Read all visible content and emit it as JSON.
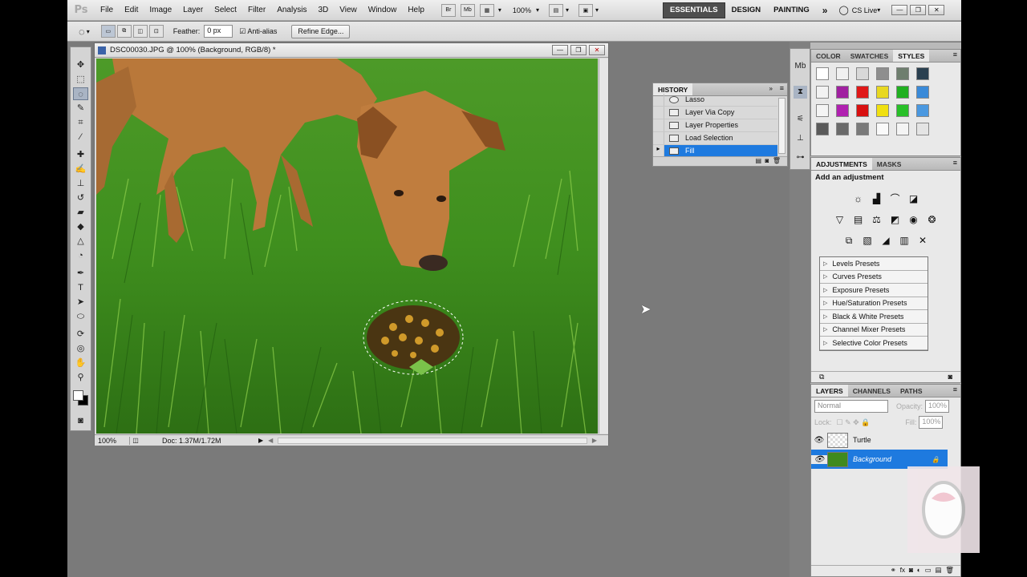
{
  "menubar": {
    "logo": "Ps",
    "items": [
      "File",
      "Edit",
      "Image",
      "Layer",
      "Select",
      "Filter",
      "Analysis",
      "3D",
      "View",
      "Window",
      "Help"
    ],
    "zoom": "100%",
    "workspaces": [
      "ESSENTIALS",
      "DESIGN",
      "PAINTING"
    ],
    "more": "»",
    "cslive": "CS Live"
  },
  "options": {
    "feather_label": "Feather:",
    "feather_value": "0 px",
    "antialias_label": "Anti-alias",
    "refine_label": "Refine Edge..."
  },
  "document": {
    "title": "DSC00030.JPG @ 100% (Background, RGB/8) *",
    "zoom": "100%",
    "doc_info": "Doc: 1.37M/1.72M"
  },
  "history": {
    "title": "HISTORY",
    "items": [
      "Lasso",
      "Layer Via Copy",
      "Layer Properties",
      "Load Selection",
      "Fill"
    ],
    "selected_index": 4
  },
  "styles_panel": {
    "tabs": [
      "COLOR",
      "SWATCHES",
      "STYLES"
    ],
    "active_tab": "STYLES"
  },
  "adjustments": {
    "tabs": [
      "ADJUSTMENTS",
      "MASKS"
    ],
    "heading": "Add an adjustment",
    "presets": [
      "Levels Presets",
      "Curves Presets",
      "Exposure Presets",
      "Hue/Saturation Presets",
      "Black & White Presets",
      "Channel Mixer Presets",
      "Selective Color Presets"
    ]
  },
  "layers": {
    "tabs": [
      "LAYERS",
      "CHANNELS",
      "PATHS"
    ],
    "blend_mode": "Normal",
    "opacity_label": "Opacity:",
    "opacity_value": "100%",
    "lock_label": "Lock:",
    "fill_label": "Fill:",
    "fill_value": "100%",
    "items": [
      {
        "name": "Turtle",
        "selected": false
      },
      {
        "name": "Background",
        "selected": true
      }
    ]
  },
  "colors": {
    "selection": "#1e7adf",
    "active_workspace": "#4e4e4e"
  }
}
